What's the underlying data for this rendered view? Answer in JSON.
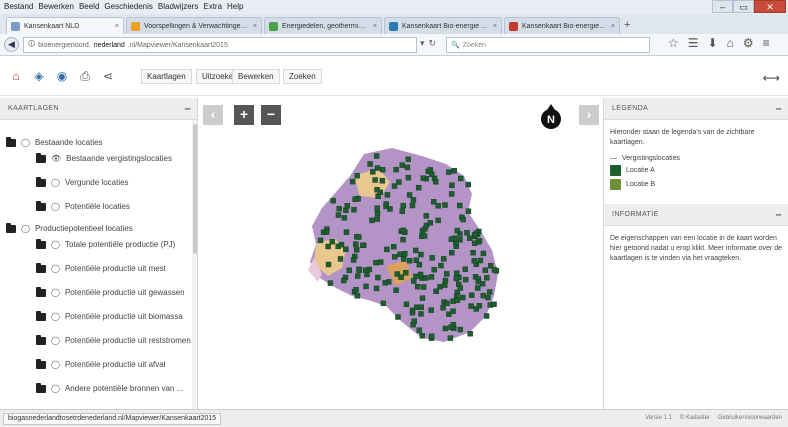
{
  "browser": {
    "menus": [
      "Bestand",
      "Bewerken",
      "Beeld",
      "Geschiedenis",
      "Bladwijzers",
      "Extra",
      "Help"
    ],
    "tabs": [
      {
        "label": "Kansenkaart NLD",
        "active": true,
        "favicon_color": "#7a9cc6"
      },
      {
        "label": "Voorspellingen & Verwachtingen Noord...",
        "active": false,
        "favicon_color": "#f0a020"
      },
      {
        "label": "Energiedelen, geothermie Noord...",
        "active": false,
        "favicon_color": "#4aa04a"
      },
      {
        "label": "Kansenkaart Bio-energie ...",
        "active": false,
        "favicon_color": "#2a7ab8"
      },
      {
        "label": "Kansenkaart Bio-energie (...",
        "active": false,
        "favicon_color": "#c0392b"
      }
    ],
    "url_prefix": "bioenergienoord.",
    "url_host": "nederland",
    "url_rest": ".nl/Mapviewer/Kansenkaart2015",
    "search_placeholder": "Zoeken",
    "status_url": "biogasnederlandtosetrdenederland.nl/Mapviewer/Kansenkaart2015",
    "status_right": [
      "Versie 1.1",
      "© Kadaster",
      "Gebruikersvoorwaarden"
    ]
  },
  "toolbar": {
    "menus": [
      "Kaartlagen",
      "Uitzoeken",
      "Bewerken",
      "Zoeken"
    ]
  },
  "left_panel": {
    "title": "KAARTLAGEN",
    "groups": [
      {
        "label": "Bestaande locaties",
        "layers": [
          "Bestaande vergistingslocaties",
          "Vergunde locaties",
          "Potentiële locaties"
        ]
      },
      {
        "label": "Productiepotentieel locaties",
        "layers": [
          "Totale potentiële productie (PJ)",
          "Potentiële productie uit mest",
          "Potentiële productie uit gewassen",
          "Potentiële productie uit biomassa",
          "Potentiële productie uit reststromen",
          "Potentiële productie uit afval",
          "Andere potentiële bronnen van ..."
        ]
      }
    ]
  },
  "legend": {
    "title": "LEGENDA",
    "intro": "Hieronder staan de legenda's van de zichtbare kaartlagen.",
    "section": "Vergistingslocaties",
    "items": [
      {
        "label": "Locatie A",
        "color": "#1d5e2f"
      },
      {
        "label": "Locatie B",
        "color": "#6d8f3a"
      }
    ]
  },
  "info": {
    "title": "INFORMATIE",
    "text": "De eigenschappen van een locatie in de kaart worden hier getoond nadat u erop klikt. Meer informatie over de kaartlagen is te vinden via het vraagteken."
  },
  "colors": {
    "panel_header_bg": "#eeeeee",
    "map_button": "#555555",
    "location_marker": "#1d5e2f",
    "region_purple": "#b493c7",
    "region_tan": "#e9c88f"
  }
}
